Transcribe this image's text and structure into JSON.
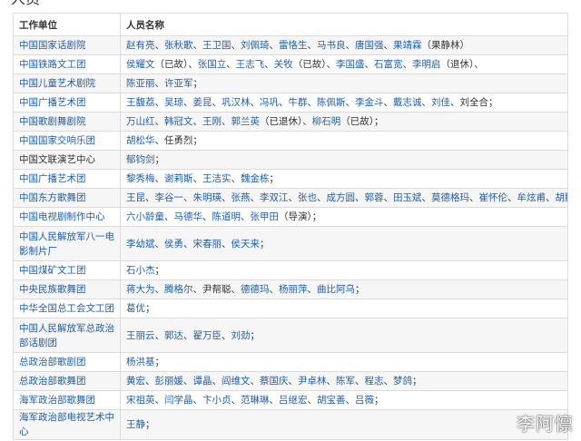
{
  "section_title": "人员",
  "table": {
    "headers": {
      "unit": "工作单位",
      "people": "人员名称"
    },
    "rows": [
      {
        "unit": "中国国家话剧院",
        "unit_link": true,
        "people": [
          {
            "t": "赵有亮",
            "l": true
          },
          {
            "t": "、",
            "l": false
          },
          {
            "t": "张秋歌",
            "l": true
          },
          {
            "t": "、",
            "l": false
          },
          {
            "t": "王卫国",
            "l": true
          },
          {
            "t": "、",
            "l": false
          },
          {
            "t": "刘佩琦",
            "l": true
          },
          {
            "t": "、",
            "l": false
          },
          {
            "t": "雷恪生",
            "l": true
          },
          {
            "t": "、",
            "l": false
          },
          {
            "t": "马书良",
            "l": true
          },
          {
            "t": "、",
            "l": false
          },
          {
            "t": "唐国强",
            "l": true
          },
          {
            "t": "、",
            "l": false
          },
          {
            "t": "果靖霖",
            "l": true
          },
          {
            "t": "（果静林）",
            "l": false
          }
        ]
      },
      {
        "unit": "中国铁路文工团",
        "unit_link": true,
        "people": [
          {
            "t": "侯耀文",
            "l": true
          },
          {
            "t": "（已故）、",
            "l": false
          },
          {
            "t": "张国立",
            "l": true
          },
          {
            "t": "、",
            "l": false
          },
          {
            "t": "王志飞",
            "l": true
          },
          {
            "t": "、",
            "l": false
          },
          {
            "t": "关牧",
            "l": true
          },
          {
            "t": "（已故）、",
            "l": false
          },
          {
            "t": "李国盛",
            "l": true
          },
          {
            "t": "、",
            "l": false
          },
          {
            "t": "石富宽",
            "l": true
          },
          {
            "t": "、",
            "l": false
          },
          {
            "t": "李明启",
            "l": true
          },
          {
            "t": "（退休）、",
            "l": false
          }
        ]
      },
      {
        "unit": "中国儿童艺术剧院",
        "unit_link": true,
        "people": [
          {
            "t": "陈亚丽",
            "l": true
          },
          {
            "t": "、",
            "l": false
          },
          {
            "t": "许亚军",
            "l": true
          },
          {
            "t": "；",
            "l": false
          }
        ]
      },
      {
        "unit": "中国广播艺术团",
        "unit_link": true,
        "people": [
          {
            "t": "王馥荔",
            "l": true
          },
          {
            "t": "、",
            "l": false
          },
          {
            "t": "吴琼",
            "l": true
          },
          {
            "t": "、",
            "l": false
          },
          {
            "t": "姜昆",
            "l": true
          },
          {
            "t": "、",
            "l": false
          },
          {
            "t": "巩汉林",
            "l": true
          },
          {
            "t": "、",
            "l": false
          },
          {
            "t": "冯巩",
            "l": true
          },
          {
            "t": "、",
            "l": false
          },
          {
            "t": "牛群",
            "l": true
          },
          {
            "t": "、",
            "l": false
          },
          {
            "t": "陈佩斯",
            "l": true
          },
          {
            "t": "、",
            "l": false
          },
          {
            "t": "李金斗",
            "l": true
          },
          {
            "t": "、",
            "l": false
          },
          {
            "t": "戴志诚",
            "l": true
          },
          {
            "t": "、",
            "l": false
          },
          {
            "t": "刘佳",
            "l": true
          },
          {
            "t": "、刘全合；",
            "l": false
          }
        ]
      },
      {
        "unit": "中国歌剧舞剧院",
        "unit_link": true,
        "people": [
          {
            "t": "万山红",
            "l": true
          },
          {
            "t": "、",
            "l": false
          },
          {
            "t": "韩冠文",
            "l": true
          },
          {
            "t": "、",
            "l": false
          },
          {
            "t": "王刚",
            "l": true
          },
          {
            "t": "、",
            "l": false
          },
          {
            "t": "郭兰英",
            "l": true
          },
          {
            "t": "（已退休）、",
            "l": false
          },
          {
            "t": "柳石明",
            "l": true
          },
          {
            "t": "（已故）；",
            "l": false
          }
        ]
      },
      {
        "unit": "中国国家交响乐团",
        "unit_link": true,
        "people": [
          {
            "t": "胡松华",
            "l": true
          },
          {
            "t": "、任勇烈；",
            "l": false
          }
        ]
      },
      {
        "unit": "中国文联演艺中心",
        "unit_link": false,
        "people": [
          {
            "t": "郁钧剑",
            "l": true
          },
          {
            "t": "；",
            "l": false
          }
        ]
      },
      {
        "unit": "中国广播艺术团",
        "unit_link": true,
        "people": [
          {
            "t": "黎秀梅",
            "l": true
          },
          {
            "t": "、",
            "l": false
          },
          {
            "t": "谢莉斯",
            "l": true
          },
          {
            "t": "、",
            "l": false
          },
          {
            "t": "王洁实",
            "l": true
          },
          {
            "t": "、",
            "l": false
          },
          {
            "t": "魏金栋",
            "l": true
          },
          {
            "t": "；",
            "l": false
          }
        ]
      },
      {
        "unit": "中国东方歌舞团",
        "unit_link": true,
        "people": [
          {
            "t": "王昆",
            "l": true
          },
          {
            "t": "、",
            "l": false
          },
          {
            "t": "李谷一",
            "l": true
          },
          {
            "t": "、",
            "l": false
          },
          {
            "t": "朱明瑛",
            "l": true
          },
          {
            "t": "、",
            "l": false
          },
          {
            "t": "张燕",
            "l": true
          },
          {
            "t": "、",
            "l": false
          },
          {
            "t": "李双江",
            "l": true
          },
          {
            "t": "、",
            "l": false
          },
          {
            "t": "张也",
            "l": true
          },
          {
            "t": "、",
            "l": false
          },
          {
            "t": "成方圆",
            "l": true
          },
          {
            "t": "、",
            "l": false
          },
          {
            "t": "郭蓉",
            "l": true
          },
          {
            "t": "、",
            "l": false
          },
          {
            "t": "田玉斌",
            "l": true
          },
          {
            "t": "、",
            "l": false
          },
          {
            "t": "莫德格玛",
            "l": true
          },
          {
            "t": "、",
            "l": false
          },
          {
            "t": "崔怀伦",
            "l": true
          },
          {
            "t": "、",
            "l": false
          },
          {
            "t": "牟炫甫",
            "l": true
          },
          {
            "t": "、",
            "l": false
          },
          {
            "t": "胡鹏",
            "l": true
          },
          {
            "t": "；",
            "l": false
          }
        ]
      },
      {
        "unit": "中国电视剧制作中心",
        "unit_link": true,
        "people": [
          {
            "t": "六小龄童",
            "l": true
          },
          {
            "t": "、",
            "l": false
          },
          {
            "t": "马德华",
            "l": true
          },
          {
            "t": "、",
            "l": false
          },
          {
            "t": "陈道明",
            "l": true
          },
          {
            "t": "、",
            "l": false
          },
          {
            "t": "张甲田",
            "l": true
          },
          {
            "t": "（导演）；",
            "l": false
          }
        ]
      },
      {
        "unit": "中国人民解放军八一电影制片厂",
        "unit_link": true,
        "people": [
          {
            "t": "李幼斌",
            "l": true
          },
          {
            "t": "、",
            "l": false
          },
          {
            "t": "侯勇",
            "l": true
          },
          {
            "t": "、",
            "l": false
          },
          {
            "t": "宋春丽",
            "l": true
          },
          {
            "t": "、",
            "l": false
          },
          {
            "t": "侯天来",
            "l": true
          },
          {
            "t": "；",
            "l": false
          }
        ]
      },
      {
        "unit": "中国煤矿文工团",
        "unit_link": true,
        "people": [
          {
            "t": "石小杰",
            "l": true
          },
          {
            "t": "；",
            "l": false
          }
        ]
      },
      {
        "unit": "中央民族歌舞团",
        "unit_link": true,
        "people": [
          {
            "t": "蒋大为",
            "l": true
          },
          {
            "t": "、",
            "l": false
          },
          {
            "t": "腾格尔",
            "l": true
          },
          {
            "t": "、尹帮聪、",
            "l": false
          },
          {
            "t": "德德玛",
            "l": true
          },
          {
            "t": "、",
            "l": false
          },
          {
            "t": "杨丽萍",
            "l": true
          },
          {
            "t": "、",
            "l": false
          },
          {
            "t": "曲比阿乌",
            "l": true
          },
          {
            "t": "；",
            "l": false
          }
        ]
      },
      {
        "unit": "中华全国总工会文工团",
        "unit_link": true,
        "people": [
          {
            "t": "葛优",
            "l": true
          },
          {
            "t": "；",
            "l": false
          }
        ]
      },
      {
        "unit": "中国人民解放军总政治部话剧团",
        "unit_link": true,
        "people": [
          {
            "t": "王丽云",
            "l": true
          },
          {
            "t": "、",
            "l": false
          },
          {
            "t": "郭达",
            "l": true
          },
          {
            "t": "、",
            "l": false
          },
          {
            "t": "翟万臣",
            "l": true
          },
          {
            "t": "、",
            "l": false
          },
          {
            "t": "刘劲",
            "l": true
          },
          {
            "t": "；",
            "l": false
          }
        ]
      },
      {
        "unit": "总政治部歌剧团",
        "unit_link": true,
        "people": [
          {
            "t": "杨洪基",
            "l": true
          },
          {
            "t": "；",
            "l": false
          }
        ]
      },
      {
        "unit": "总政治部歌舞团",
        "unit_link": true,
        "people": [
          {
            "t": "黄宏",
            "l": true
          },
          {
            "t": "、",
            "l": false
          },
          {
            "t": "彭丽媛",
            "l": true
          },
          {
            "t": "、",
            "l": false
          },
          {
            "t": "谭晶",
            "l": true
          },
          {
            "t": "、",
            "l": false
          },
          {
            "t": "阎维文",
            "l": true
          },
          {
            "t": "、",
            "l": false
          },
          {
            "t": "蔡国庆",
            "l": true
          },
          {
            "t": "、",
            "l": false
          },
          {
            "t": "尹卓林",
            "l": true
          },
          {
            "t": "、",
            "l": false
          },
          {
            "t": "陈军",
            "l": true
          },
          {
            "t": "、",
            "l": false
          },
          {
            "t": "程志",
            "l": true
          },
          {
            "t": "、",
            "l": false
          },
          {
            "t": "梦鸽",
            "l": true
          },
          {
            "t": "；",
            "l": false
          }
        ]
      },
      {
        "unit": "海军政治部歌舞团",
        "unit_link": true,
        "people": [
          {
            "t": "宋祖英",
            "l": true
          },
          {
            "t": "、",
            "l": false
          },
          {
            "t": "闫学晶",
            "l": true
          },
          {
            "t": "、",
            "l": false
          },
          {
            "t": "卞小贞",
            "l": true
          },
          {
            "t": "、",
            "l": false
          },
          {
            "t": "范琳琳",
            "l": true
          },
          {
            "t": "、",
            "l": false
          },
          {
            "t": "吕继宏",
            "l": true
          },
          {
            "t": "、",
            "l": false
          },
          {
            "t": "胡宝善",
            "l": true
          },
          {
            "t": "、",
            "l": false
          },
          {
            "t": "吕薇",
            "l": true
          },
          {
            "t": "；",
            "l": false
          }
        ]
      },
      {
        "unit": "海军政治部电视艺术中心",
        "unit_link": true,
        "people": [
          {
            "t": "王静",
            "l": true
          },
          {
            "t": "；",
            "l": false
          }
        ]
      }
    ]
  },
  "watermark": "李阿懔",
  "colors": {
    "link": "#1f5fa8",
    "text": "#333333",
    "border": "#dcdcdc",
    "row_alt": "#f6f6f6"
  }
}
